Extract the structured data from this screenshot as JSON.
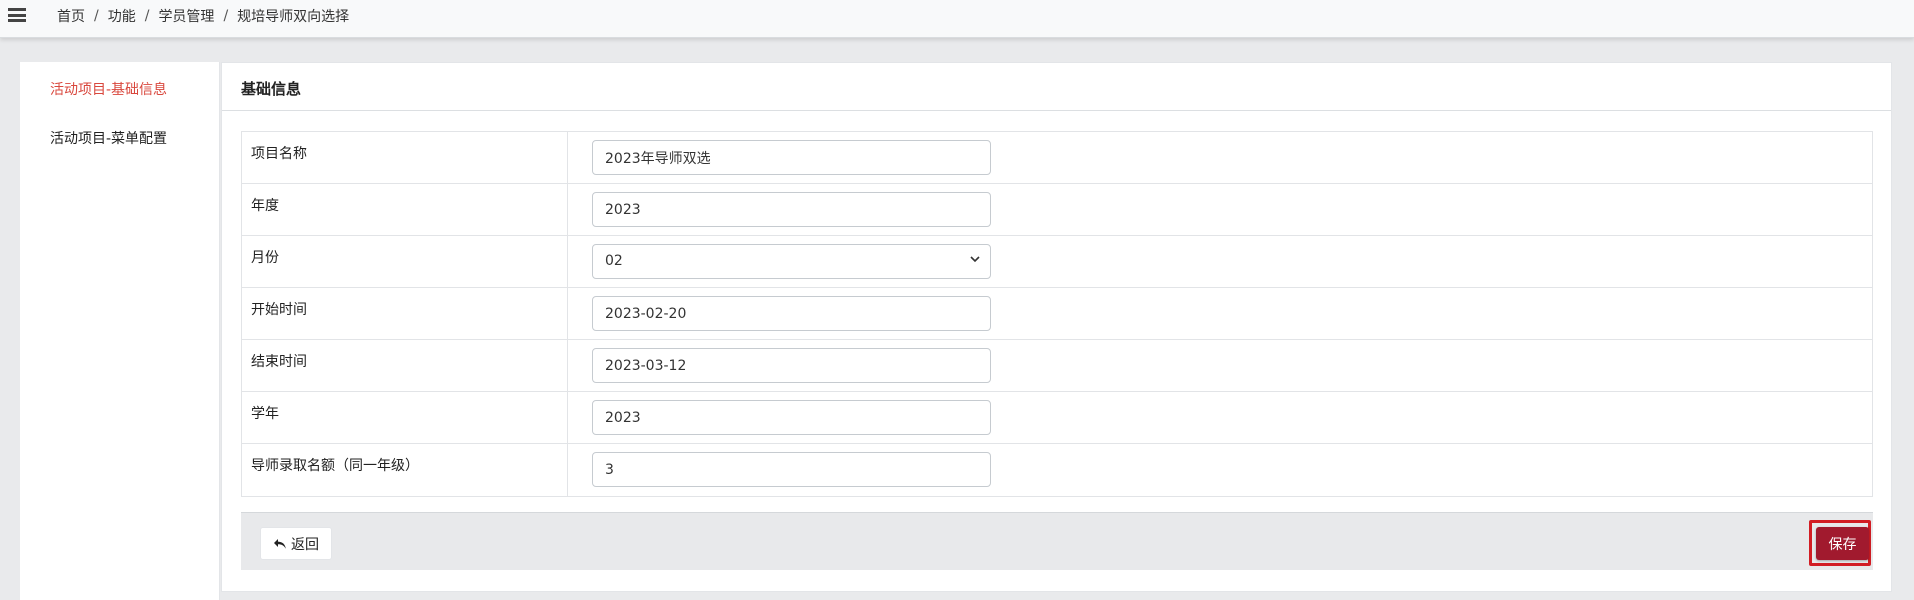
{
  "breadcrumb": [
    "首页",
    "功能",
    "学员管理",
    "规培导师双向选择"
  ],
  "breadcrumb_sep": "/",
  "sidebar": {
    "items": [
      {
        "label": "活动项目-基础信息",
        "active": true
      },
      {
        "label": "活动项目-菜单配置",
        "active": false
      }
    ]
  },
  "panel": {
    "title": "基础信息",
    "rows": [
      {
        "label": "项目名称",
        "value": "2023年导师双选"
      },
      {
        "label": "年度",
        "value": "2023"
      },
      {
        "label": "月份",
        "value": "02"
      },
      {
        "label": "开始时间",
        "value": "2023-02-20"
      },
      {
        "label": "结束时间",
        "value": "2023-03-12"
      },
      {
        "label": "学年",
        "value": "2023"
      },
      {
        "label": "导师录取名额（同一年级）",
        "value": "3"
      }
    ]
  },
  "actions": {
    "back_label": "返回",
    "save_label": "保存"
  },
  "colors": {
    "active_sidebar": "#d9473d",
    "save_button": "#a11a2e",
    "highlight_border": "#d21d24"
  }
}
